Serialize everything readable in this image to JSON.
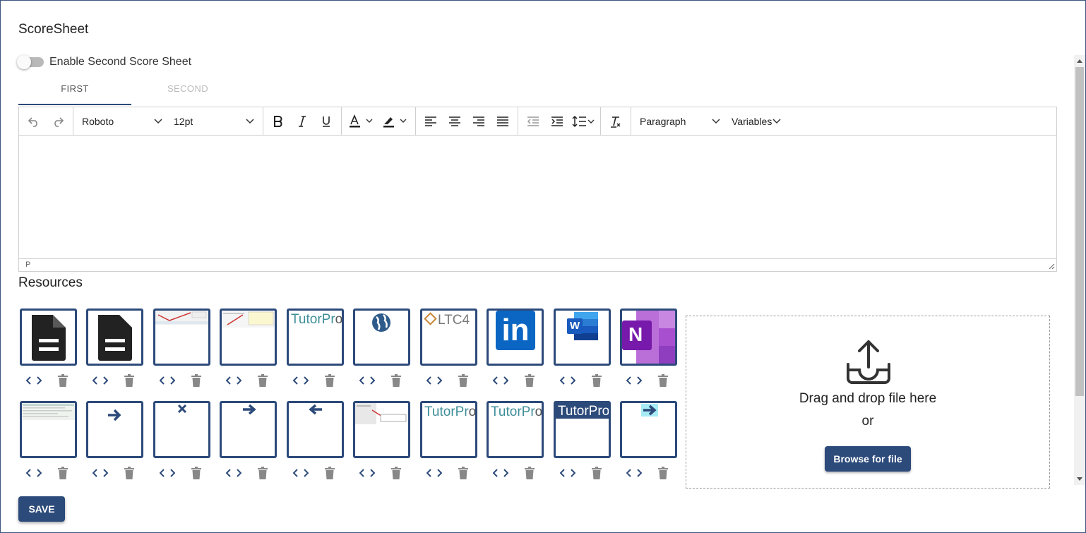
{
  "page": {
    "title": "ScoreSheet"
  },
  "toggle": {
    "label": "Enable Second Score Sheet",
    "enabled": false
  },
  "tabs": [
    {
      "label": "FIRST",
      "active": true
    },
    {
      "label": "SECOND",
      "active": false
    }
  ],
  "editor": {
    "toolbar": {
      "font_family": "Roboto",
      "font_size": "12pt",
      "block_format": "Paragraph",
      "variables": "Variables",
      "icons": [
        "undo-icon",
        "redo-icon",
        "bold-icon",
        "italic-icon",
        "underline-icon",
        "text-color-icon",
        "highlight-icon",
        "align-left-icon",
        "align-center-icon",
        "align-right-icon",
        "justify-icon",
        "outdent-icon",
        "indent-icon",
        "line-height-icon",
        "clear-format-icon"
      ]
    },
    "status_path": "P"
  },
  "resources": {
    "title": "Resources",
    "items": [
      {
        "kind": "document-icon"
      },
      {
        "kind": "document-icon"
      },
      {
        "kind": "screenshot-thumb"
      },
      {
        "kind": "screenshot-thumb"
      },
      {
        "kind": "tutorpro-logo",
        "text": "TutorPro"
      },
      {
        "kind": "globe-icon"
      },
      {
        "kind": "ltc4-logo",
        "text": "LTC4"
      },
      {
        "kind": "linkedin-icon",
        "text": "in"
      },
      {
        "kind": "word-icon",
        "text": "W"
      },
      {
        "kind": "onenote-icon",
        "text": "N"
      },
      {
        "kind": "screenshot-thumb"
      },
      {
        "kind": "arrow-right-icon"
      },
      {
        "kind": "close-x-icon"
      },
      {
        "kind": "arrow-right-icon"
      },
      {
        "kind": "arrow-left-icon"
      },
      {
        "kind": "screenshot-thumb"
      },
      {
        "kind": "tutorpro-logo",
        "text": "TutorPro"
      },
      {
        "kind": "tutorpro-logo",
        "text": "TutorPro"
      },
      {
        "kind": "tutorpro-logo-dark",
        "text": "TutorPro"
      },
      {
        "kind": "arrow-right-highlight-icon"
      }
    ]
  },
  "upload": {
    "drop_text": "Drag and drop file here",
    "or_text": "or",
    "browse_label": "Browse for file"
  },
  "save_label": "SAVE",
  "colors": {
    "primary": "#2c4a7a",
    "border": "#cfcfcf"
  }
}
